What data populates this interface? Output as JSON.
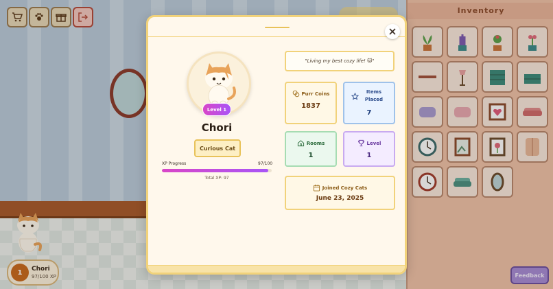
{
  "inventory": {
    "title": "Inventory",
    "items": [
      "potted-plant-icon",
      "lavender-plant-icon",
      "flower-pot-icon",
      "tulip-plant-icon",
      "wall-shelf-icon",
      "floor-lamp-icon",
      "teal-dresser-icon",
      "teal-nightstand-icon",
      "lavender-pillow-icon",
      "pink-pillow-icon",
      "heart-frame-icon",
      "pink-sofa-icon",
      "wall-clock-icon",
      "framed-picture-icon",
      "flower-frame-icon",
      "wardrobe-icon",
      "wall-clock-red-icon",
      "teal-loveseat-icon",
      "oval-mirror-icon"
    ],
    "feedback_label": "Feedback"
  },
  "player": {
    "level_badge": "1",
    "name": "Chori",
    "xp_text": "97/100 XP"
  },
  "profile": {
    "level_pill": "Level 1",
    "name": "Chori",
    "title_badge": "Curious Cat",
    "xp_label": "XP Progress",
    "xp_value": "97/100",
    "xp_progress": 0.97,
    "xp_total": "Total XP: 97",
    "quote": "\"Living my best cozy life! 🐱\"",
    "stats": {
      "coins": {
        "label": "Purr Coins",
        "value": "1837"
      },
      "items": {
        "label": "Items Placed",
        "value": "7"
      },
      "rooms": {
        "label": "Rooms",
        "value": "1"
      },
      "level": {
        "label": "Level",
        "value": "1"
      },
      "joined": {
        "label": "Joined Cozy Cats",
        "value": "June 23, 2025"
      }
    }
  },
  "colors": {
    "accent_gradient_start": "#d946c7",
    "accent_gradient_end": "#a855f7",
    "modal_border": "#f1d27a",
    "inventory_bg": "#f0c2a8"
  }
}
